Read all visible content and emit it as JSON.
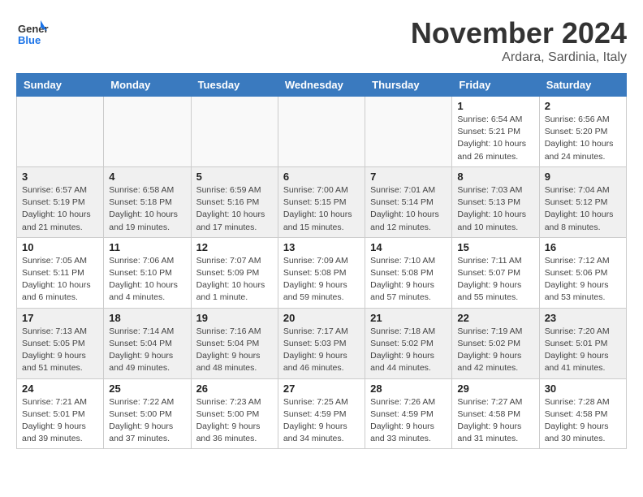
{
  "header": {
    "logo_line1": "General",
    "logo_line2": "Blue",
    "month": "November 2024",
    "location": "Ardara, Sardinia, Italy"
  },
  "weekdays": [
    "Sunday",
    "Monday",
    "Tuesday",
    "Wednesday",
    "Thursday",
    "Friday",
    "Saturday"
  ],
  "weeks": [
    [
      {
        "day": "",
        "info": ""
      },
      {
        "day": "",
        "info": ""
      },
      {
        "day": "",
        "info": ""
      },
      {
        "day": "",
        "info": ""
      },
      {
        "day": "",
        "info": ""
      },
      {
        "day": "1",
        "info": "Sunrise: 6:54 AM\nSunset: 5:21 PM\nDaylight: 10 hours and 26 minutes."
      },
      {
        "day": "2",
        "info": "Sunrise: 6:56 AM\nSunset: 5:20 PM\nDaylight: 10 hours and 24 minutes."
      }
    ],
    [
      {
        "day": "3",
        "info": "Sunrise: 6:57 AM\nSunset: 5:19 PM\nDaylight: 10 hours and 21 minutes."
      },
      {
        "day": "4",
        "info": "Sunrise: 6:58 AM\nSunset: 5:18 PM\nDaylight: 10 hours and 19 minutes."
      },
      {
        "day": "5",
        "info": "Sunrise: 6:59 AM\nSunset: 5:16 PM\nDaylight: 10 hours and 17 minutes."
      },
      {
        "day": "6",
        "info": "Sunrise: 7:00 AM\nSunset: 5:15 PM\nDaylight: 10 hours and 15 minutes."
      },
      {
        "day": "7",
        "info": "Sunrise: 7:01 AM\nSunset: 5:14 PM\nDaylight: 10 hours and 12 minutes."
      },
      {
        "day": "8",
        "info": "Sunrise: 7:03 AM\nSunset: 5:13 PM\nDaylight: 10 hours and 10 minutes."
      },
      {
        "day": "9",
        "info": "Sunrise: 7:04 AM\nSunset: 5:12 PM\nDaylight: 10 hours and 8 minutes."
      }
    ],
    [
      {
        "day": "10",
        "info": "Sunrise: 7:05 AM\nSunset: 5:11 PM\nDaylight: 10 hours and 6 minutes."
      },
      {
        "day": "11",
        "info": "Sunrise: 7:06 AM\nSunset: 5:10 PM\nDaylight: 10 hours and 4 minutes."
      },
      {
        "day": "12",
        "info": "Sunrise: 7:07 AM\nSunset: 5:09 PM\nDaylight: 10 hours and 1 minute."
      },
      {
        "day": "13",
        "info": "Sunrise: 7:09 AM\nSunset: 5:08 PM\nDaylight: 9 hours and 59 minutes."
      },
      {
        "day": "14",
        "info": "Sunrise: 7:10 AM\nSunset: 5:08 PM\nDaylight: 9 hours and 57 minutes."
      },
      {
        "day": "15",
        "info": "Sunrise: 7:11 AM\nSunset: 5:07 PM\nDaylight: 9 hours and 55 minutes."
      },
      {
        "day": "16",
        "info": "Sunrise: 7:12 AM\nSunset: 5:06 PM\nDaylight: 9 hours and 53 minutes."
      }
    ],
    [
      {
        "day": "17",
        "info": "Sunrise: 7:13 AM\nSunset: 5:05 PM\nDaylight: 9 hours and 51 minutes."
      },
      {
        "day": "18",
        "info": "Sunrise: 7:14 AM\nSunset: 5:04 PM\nDaylight: 9 hours and 49 minutes."
      },
      {
        "day": "19",
        "info": "Sunrise: 7:16 AM\nSunset: 5:04 PM\nDaylight: 9 hours and 48 minutes."
      },
      {
        "day": "20",
        "info": "Sunrise: 7:17 AM\nSunset: 5:03 PM\nDaylight: 9 hours and 46 minutes."
      },
      {
        "day": "21",
        "info": "Sunrise: 7:18 AM\nSunset: 5:02 PM\nDaylight: 9 hours and 44 minutes."
      },
      {
        "day": "22",
        "info": "Sunrise: 7:19 AM\nSunset: 5:02 PM\nDaylight: 9 hours and 42 minutes."
      },
      {
        "day": "23",
        "info": "Sunrise: 7:20 AM\nSunset: 5:01 PM\nDaylight: 9 hours and 41 minutes."
      }
    ],
    [
      {
        "day": "24",
        "info": "Sunrise: 7:21 AM\nSunset: 5:01 PM\nDaylight: 9 hours and 39 minutes."
      },
      {
        "day": "25",
        "info": "Sunrise: 7:22 AM\nSunset: 5:00 PM\nDaylight: 9 hours and 37 minutes."
      },
      {
        "day": "26",
        "info": "Sunrise: 7:23 AM\nSunset: 5:00 PM\nDaylight: 9 hours and 36 minutes."
      },
      {
        "day": "27",
        "info": "Sunrise: 7:25 AM\nSunset: 4:59 PM\nDaylight: 9 hours and 34 minutes."
      },
      {
        "day": "28",
        "info": "Sunrise: 7:26 AM\nSunset: 4:59 PM\nDaylight: 9 hours and 33 minutes."
      },
      {
        "day": "29",
        "info": "Sunrise: 7:27 AM\nSunset: 4:58 PM\nDaylight: 9 hours and 31 minutes."
      },
      {
        "day": "30",
        "info": "Sunrise: 7:28 AM\nSunset: 4:58 PM\nDaylight: 9 hours and 30 minutes."
      }
    ]
  ]
}
